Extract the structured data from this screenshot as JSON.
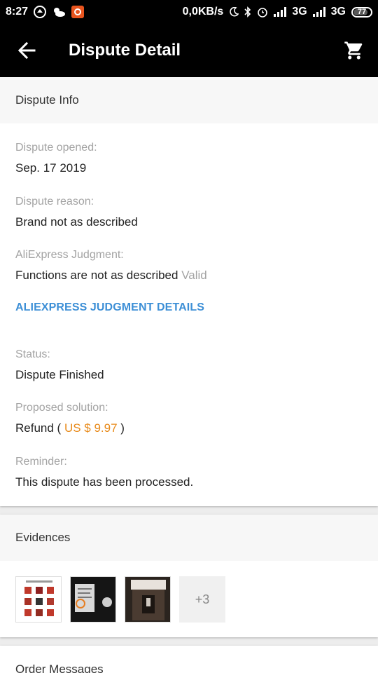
{
  "status_bar": {
    "time": "8:27",
    "speed": "0,0KB/s",
    "net1": "3G",
    "net2": "3G",
    "battery": "77"
  },
  "app_bar": {
    "title": "Dispute Detail"
  },
  "dispute_info": {
    "header": "Dispute Info",
    "opened_label": "Dispute opened:",
    "opened_value": "Sep. 17 2019",
    "reason_label": "Dispute reason:",
    "reason_value": "Brand not as described",
    "judgment_label": "AliExpress Judgment:",
    "judgment_value": "Functions are not as described",
    "judgment_status": "Valid",
    "judgment_link": "ALIEXPRESS JUDGMENT DETAILS",
    "status_label": "Status:",
    "status_value": "Dispute Finished",
    "solution_label": "Proposed solution:",
    "solution_prefix": "Refund (",
    "solution_amount": "US $ 9.97",
    "solution_suffix": ")",
    "reminder_label": "Reminder:",
    "reminder_value": "This dispute has been processed."
  },
  "evidences": {
    "header": "Evidences",
    "more_count": "+3"
  },
  "order_messages": {
    "header": "Order Messages"
  },
  "colors": {
    "link": "#3d8fd6",
    "price": "#e88a1a",
    "label": "#a3a3a3",
    "appbar": "#000000"
  },
  "icons": {
    "back": "arrow-left-icon",
    "cart": "shopping-cart-icon"
  }
}
